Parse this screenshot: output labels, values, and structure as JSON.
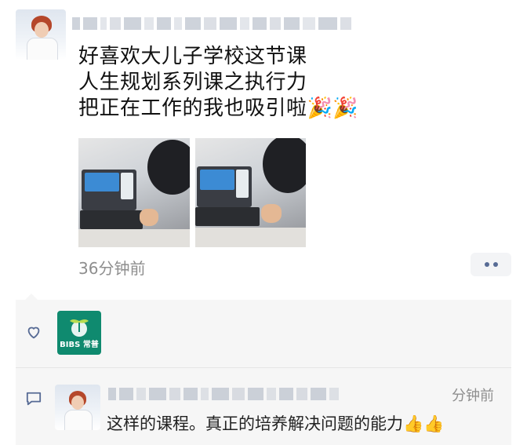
{
  "post": {
    "lines": [
      "好喜欢大儿子学校这节课",
      "人生规划系列课之执行力",
      "把正在工作的我也吸引啦🎉🎉"
    ],
    "time": "36分钟前",
    "photos": [
      "classroom-photo-1",
      "classroom-photo-2"
    ]
  },
  "likes": {
    "logo_text": "BIBS 常普"
  },
  "comment": {
    "time": "分钟前",
    "text": "这样的课程。真正的培养解决问题的能力👍👍"
  },
  "colors": {
    "link_blue": "#576b95",
    "panel_bg": "#f6f6f6",
    "logo_green": "#0f8a6f"
  }
}
